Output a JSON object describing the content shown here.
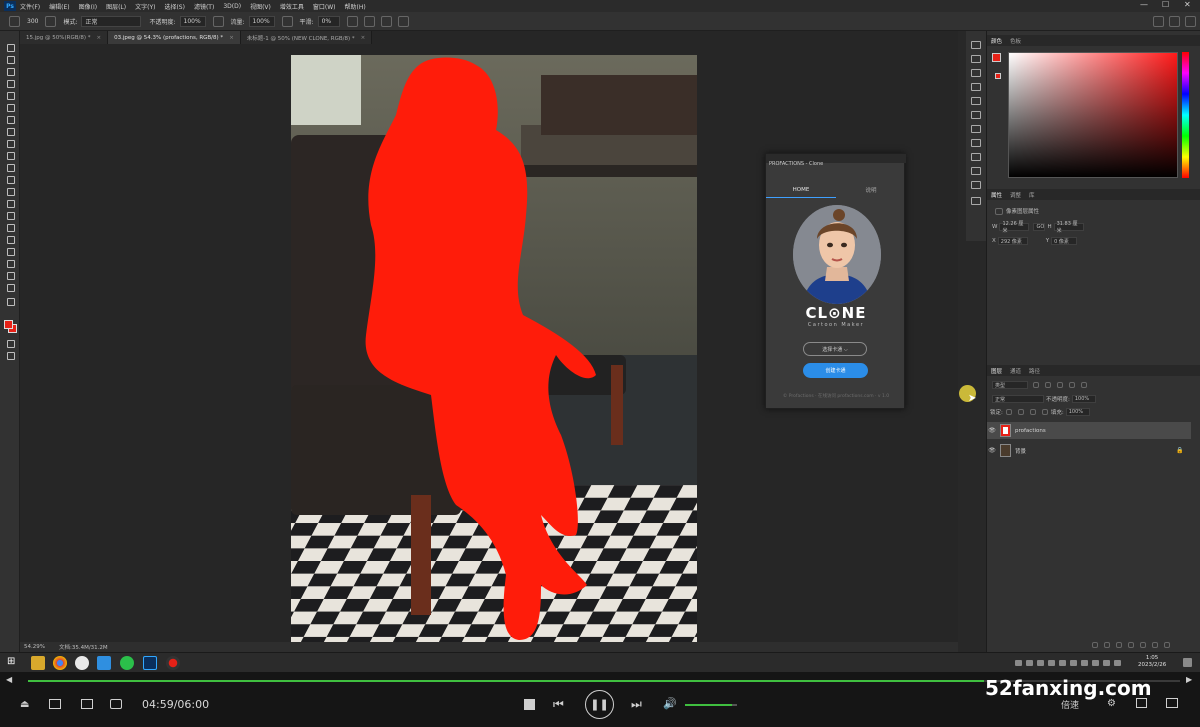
{
  "app": {
    "logo": "Ps",
    "menu": [
      "文件(F)",
      "编辑(E)",
      "图像(I)",
      "图层(L)",
      "文字(Y)",
      "选择(S)",
      "滤镜(T)",
      "3D(D)",
      "视图(V)",
      "增效工具",
      "窗口(W)",
      "帮助(H)"
    ],
    "window_controls": [
      "—",
      "☐",
      "✕"
    ]
  },
  "options_bar": {
    "brush_size": "300",
    "mode_label": "模式:",
    "mode_value": "正常",
    "opacity_label": "不透明度:",
    "opacity_value": "100%",
    "flow_label": "流量:",
    "flow_value": "100%",
    "smooth_label": "平滑:",
    "smooth_value": "0%"
  },
  "tabs": [
    {
      "label": "15.jpg @ 50%(RGB/8) *",
      "active": false
    },
    {
      "label": "03.jpeg @ 54.3% (profactions, RGB/8) *",
      "active": true
    },
    {
      "label": "未标题-1 @ 50% (NEW CLONE, RGB/8) *",
      "active": false
    }
  ],
  "status": {
    "zoom": "54.29%",
    "doc": "文档:35.4M/31.2M"
  },
  "right_panel": {
    "color_tabs": [
      "颜色",
      "色板"
    ],
    "props_tabs": [
      "属性",
      "调整",
      "库"
    ],
    "props_title": "像素图层属性",
    "w_label": "W",
    "w_value": "12.26 厘米",
    "go_label": "GO",
    "h_label": "H",
    "h_value": "31.83 厘米",
    "x_label": "X",
    "x_value": "292 像素",
    "y_label": "Y",
    "y_value": "0 像素",
    "layers_tabs": [
      "图层",
      "通道",
      "路径"
    ],
    "kind_label": "类型",
    "blend_mode": "正常",
    "opacity_label": "不透明度:",
    "opacity_value": "100%",
    "lock_label": "锁定:",
    "fill_label": "填充:",
    "fill_value": "100%",
    "layers": [
      {
        "name": "profactions",
        "selected": true
      },
      {
        "name": "背景",
        "selected": false
      }
    ]
  },
  "clone_panel": {
    "title": "PROFACTIONS - Clone",
    "tabs": [
      "HOME",
      "说明"
    ],
    "logo": "CL⊙NE",
    "logo_sub": "Cartoon Maker",
    "select_label": "选择卡通 ⌵",
    "create_label": "创建卡通",
    "footer": "© Profactions · 在线访问 profactions.com · v 1.0"
  },
  "taskbar": {
    "time": "1:05",
    "date": "2023/2/26"
  },
  "player": {
    "time": "04:59/06:00",
    "progress": 0.83,
    "volume": 0.9,
    "speed_label": "倍速",
    "watermark": "52fanxing.com"
  }
}
